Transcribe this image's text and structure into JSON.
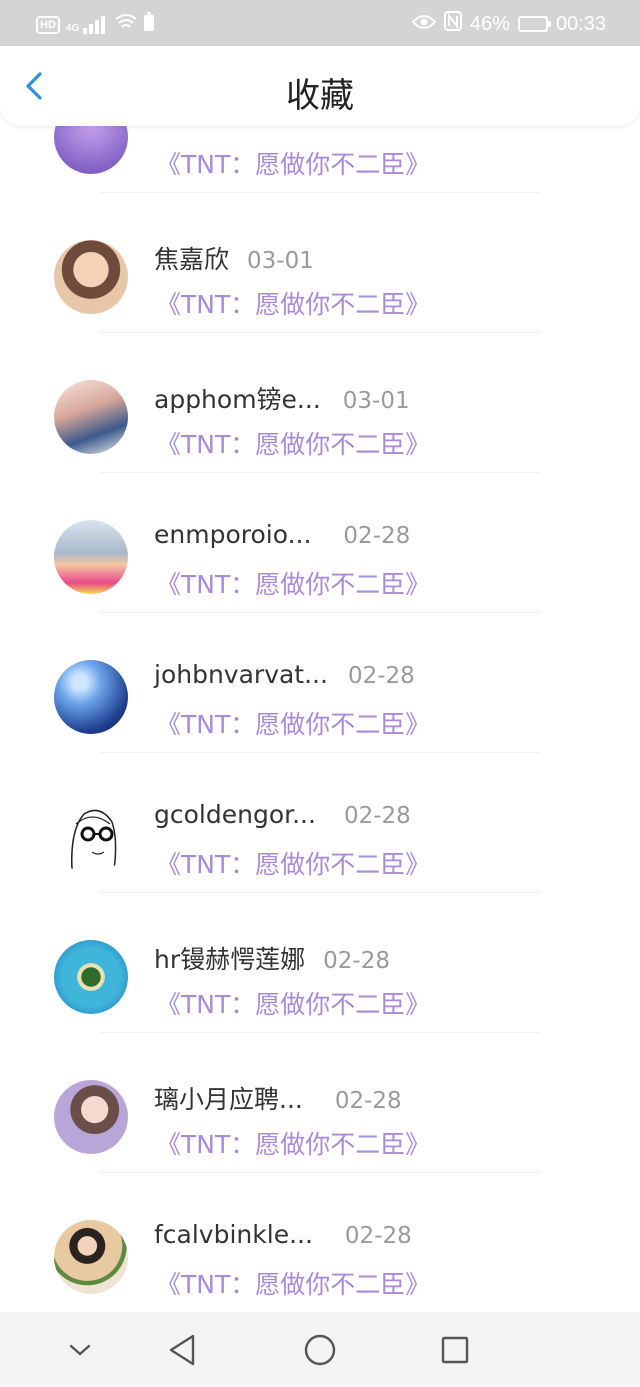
{
  "status_bar": {
    "hd_label": "HD",
    "network_label": "4G",
    "battery_percent": "46%",
    "time": "00:33"
  },
  "header": {
    "title": "收藏"
  },
  "items": [
    {
      "name": "",
      "date": "",
      "subtitle": "《TNT：愿做你不二臣》"
    },
    {
      "name": "焦嘉欣",
      "date": "03-01",
      "subtitle": "《TNT：愿做你不二臣》"
    },
    {
      "name": "apphom镑e...",
      "date": "03-01",
      "subtitle": "《TNT：愿做你不二臣》"
    },
    {
      "name": "enmporoio...",
      "date": "02-28",
      "subtitle": "《TNT：愿做你不二臣》"
    },
    {
      "name": "johbnvarvat...",
      "date": "02-28",
      "subtitle": "《TNT：愿做你不二臣》"
    },
    {
      "name": "gcoldengor...",
      "date": "02-28",
      "subtitle": "《TNT：愿做你不二臣》"
    },
    {
      "name": "hr镘赫愕莲娜",
      "date": "02-28",
      "subtitle": "《TNT：愿做你不二臣》"
    },
    {
      "name": "璃小月应聘...",
      "date": "02-28",
      "subtitle": "《TNT：愿做你不二臣》"
    },
    {
      "name": "fcalvbinkle...",
      "date": "02-28",
      "subtitle": "《TNT：愿做你不二臣》"
    }
  ],
  "colors": {
    "accent_blue": "#2f8fe0",
    "subtitle_purple": "#a88ad6",
    "status_bar_bg": "#d4d4d4"
  }
}
